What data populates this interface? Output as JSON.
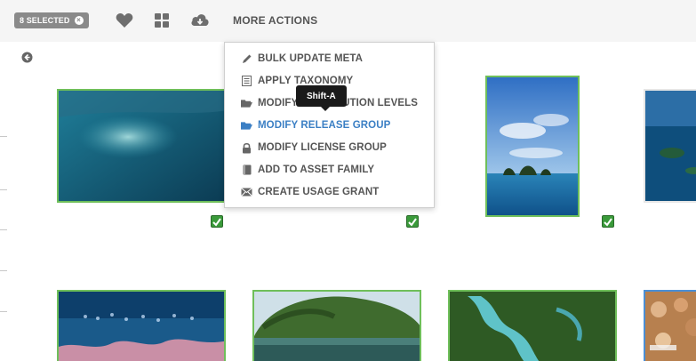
{
  "toolbar": {
    "selected_label": "8 SELECTED",
    "clear_glyph": "×",
    "icons": [
      "heart-icon",
      "grid-icon",
      "cloud-download-icon"
    ],
    "more_actions_label": "MORE ACTIONS"
  },
  "menu": {
    "items": [
      {
        "label": "BULK UPDATE META",
        "icon": "pencil-icon"
      },
      {
        "label": "APPLY TAXONOMY",
        "icon": "list-icon"
      },
      {
        "label": "MODIFY DISTRIBUTION LEVELS",
        "icon": "folder-open-icon"
      },
      {
        "label": "MODIFY RELEASE GROUP",
        "icon": "folder-open-icon",
        "active": true
      },
      {
        "label": "MODIFY LICENSE GROUP",
        "icon": "lock-icon"
      },
      {
        "label": "ADD TO ASSET FAMILY",
        "icon": "book-icon"
      },
      {
        "label": "CREATE USAGE GRANT",
        "icon": "envelope-icon"
      }
    ]
  },
  "tooltip": {
    "text": "Shift-A"
  },
  "grid": {
    "checked": [
      true,
      true,
      true
    ]
  },
  "colors": {
    "selection_border": "#6fbf5a",
    "checkbox": "#3a9a3a",
    "active_menu": "#3b7fc4",
    "tooltip_bg": "#1a1a1a"
  }
}
